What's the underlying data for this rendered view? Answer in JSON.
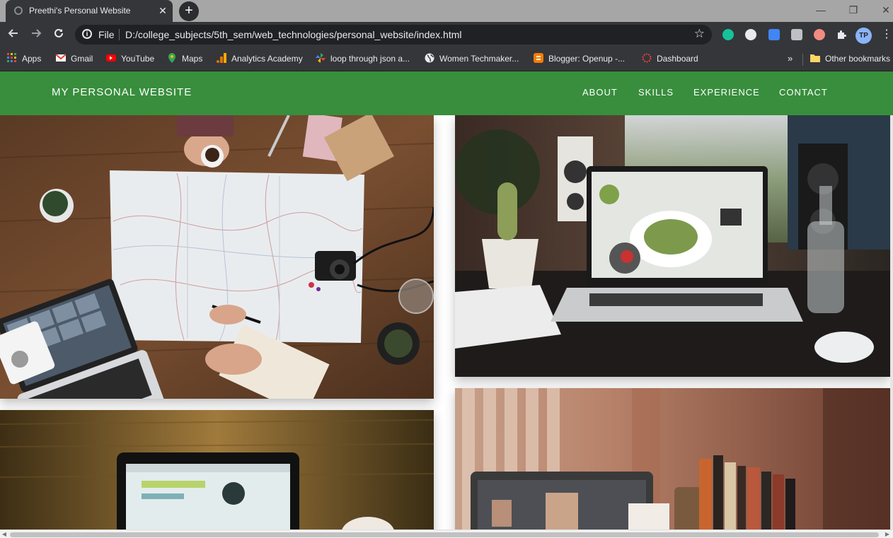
{
  "browser": {
    "tab_title": "Preethi's Personal Website",
    "tab_close": "✕",
    "new_tab": "+",
    "window_controls": {
      "minimize": "—",
      "restore": "❐",
      "close": "✕"
    },
    "scheme_label": "File",
    "url": "D:/college_subjects/5th_sem/web_technologies/personal_website/index.html",
    "profile_initials": "TP",
    "bookmarks": [
      {
        "label": "Apps",
        "icon": "apps-grid-icon",
        "color": "#ea4335"
      },
      {
        "label": "Gmail",
        "icon": "gmail-icon",
        "color": "#ea4335"
      },
      {
        "label": "YouTube",
        "icon": "youtube-icon",
        "color": "#ff0000"
      },
      {
        "label": "Maps",
        "icon": "maps-pin-icon",
        "color": "#34a853"
      },
      {
        "label": "Analytics Academy",
        "icon": "analytics-icon",
        "color": "#f9ab00"
      },
      {
        "label": "loop through json a...",
        "icon": "pinwheel-icon",
        "color": "#34a853"
      },
      {
        "label": "Women Techmaker...",
        "icon": "globe-icon",
        "color": "#e8eaed"
      },
      {
        "label": "Blogger: Openup -...",
        "icon": "blogger-icon",
        "color": "#f57c00"
      },
      {
        "label": "Dashboard",
        "icon": "dashboard-ring-icon",
        "color": "#ea4335"
      }
    ],
    "other_bookmarks": "Other bookmarks",
    "overflow": "»"
  },
  "site": {
    "brand": "MY PERSONAL WEBSITE",
    "nav": [
      "ABOUT",
      "SKILLS",
      "EXPERIENCE",
      "CONTACT"
    ],
    "accent": "#388e3c",
    "photos": [
      {
        "name": "map-travel-desk-photo",
        "subject": "map, laptop and camera on wooden desk"
      },
      {
        "name": "laptop-cactus-desk-photo",
        "subject": "laptop with cactus and water bottle"
      },
      {
        "name": "laptop-wooden-table-photo",
        "subject": "laptop on wooden table"
      },
      {
        "name": "laptop-bookshelf-photo",
        "subject": "laptop with photo editor and books"
      }
    ]
  }
}
